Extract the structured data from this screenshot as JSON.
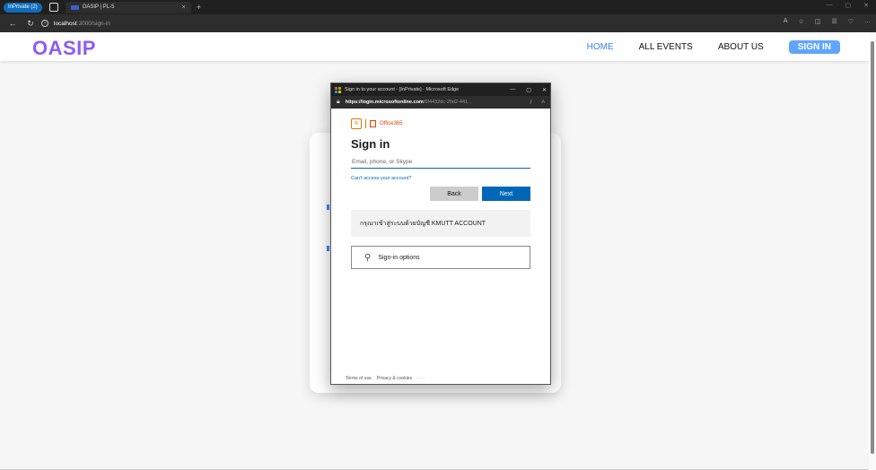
{
  "browser": {
    "inprivate_label": "InPrivate (2)",
    "tab_title": "OASIP | PL-5",
    "url_host": "localhost",
    "url_path": ":3000/sign-in",
    "tab_close": "×",
    "new_tab": "+"
  },
  "site": {
    "logo": "OASIP",
    "nav": {
      "home": "HOME",
      "all_events": "ALL EVENTS",
      "about_us": "ABOUT US",
      "sign_in": "SIGN IN"
    }
  },
  "popup": {
    "window_title": "Sign in to your account - [InPrivate] - Microsoft Edge",
    "url_host": "https://login.microsoftonline.com",
    "url_rest": "/6f4432dc-20d2-441...",
    "brand": "Office365",
    "heading": "Sign in",
    "email_placeholder": "Email, phone, or Skype",
    "cant_access": "Can't access your account?",
    "back_label": "Back",
    "next_label": "Next",
    "notice": "กรุณาเข้าสู่ระบบด้วยบัญชี KMUTT ACCOUNT",
    "options_label": "Sign-in options",
    "footer": {
      "terms": "Terms of use",
      "privacy": "Privacy & cookies",
      "more": "· · ·"
    }
  },
  "colors": {
    "logo": "#8b5cf6",
    "nav_active": "#3b82f6",
    "signin_bg": "#60a5fa",
    "ms_blue": "#0067b8"
  }
}
